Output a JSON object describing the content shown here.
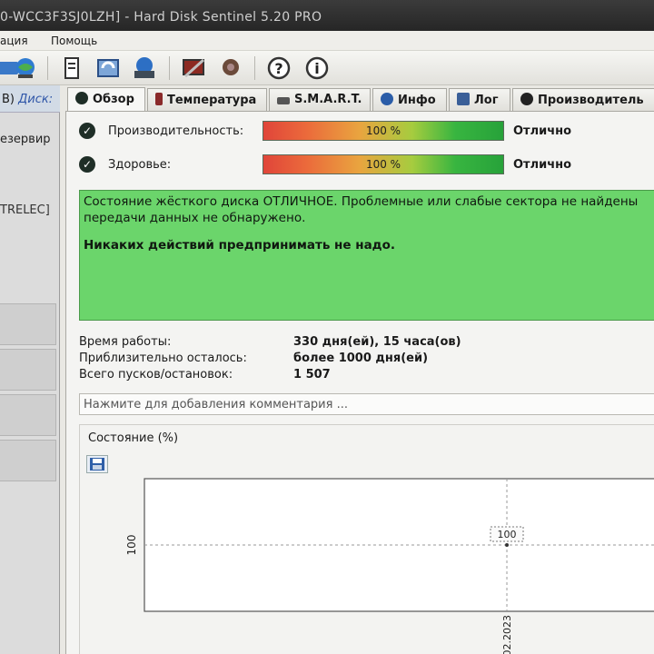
{
  "window": {
    "title": "0-WCC3F3SJ0LZH]  -  Hard Disk Sentinel 5.20 PRO"
  },
  "menu": {
    "items": [
      "ация",
      "Помощь"
    ]
  },
  "toolbar": {
    "icons": [
      "disk-icon",
      "report-icon",
      "refresh-icon",
      "network-icon",
      "test-icon",
      "sound-icon",
      "help-icon",
      "info-icon"
    ]
  },
  "sidebar": {
    "header_prefix": "B)",
    "header_disk": "Диск:",
    "reserve_label": "езервир",
    "trelec_label": "TRELEC]"
  },
  "tabs": [
    {
      "label": "Обзор",
      "icon": "check-icon"
    },
    {
      "label": "Температура",
      "icon": "thermometer-icon"
    },
    {
      "label": "S.M.A.R.T.",
      "icon": "chip-icon"
    },
    {
      "label": "Инфо",
      "icon": "info-icon"
    },
    {
      "label": "Лог",
      "icon": "log-icon"
    },
    {
      "label": "Производитель",
      "icon": "performance-icon"
    }
  ],
  "overview": {
    "performance": {
      "label": "Производительность:",
      "value_text": "100 %",
      "value": 100,
      "verdict": "Отлично"
    },
    "health": {
      "label": "Здоровье:",
      "value_text": "100 %",
      "value": 100,
      "verdict": "Отлично"
    },
    "status_line1": "Состояние жёсткого диска ОТЛИЧНОЕ. Проблемные или слабые сектора не найдены",
    "status_line2": "передачи данных не обнаружено.",
    "status_line3": "Никаких действий предпринимать не надо.",
    "status_color": "#6bd56b",
    "uptime_label": "Время работы:",
    "uptime_value": "330 дня(ей), 15 часа(ов)",
    "remaining_label": "Приблизительно осталось:",
    "remaining_value": "более 1000 дня(ей)",
    "starts_label": "Всего пусков/остановок:",
    "starts_value": "1 507",
    "comment_placeholder": "Нажмите для добавления комментария ..."
  },
  "chart_data": {
    "type": "line",
    "title": "Состояние (%)",
    "xlabel": "",
    "ylabel": "",
    "y_tick_labels": [
      "100"
    ],
    "x_tick_labels": [
      "02.2023"
    ],
    "series": [
      {
        "values": [
          100
        ]
      }
    ],
    "data_labels": [
      "100"
    ],
    "grid": true
  }
}
